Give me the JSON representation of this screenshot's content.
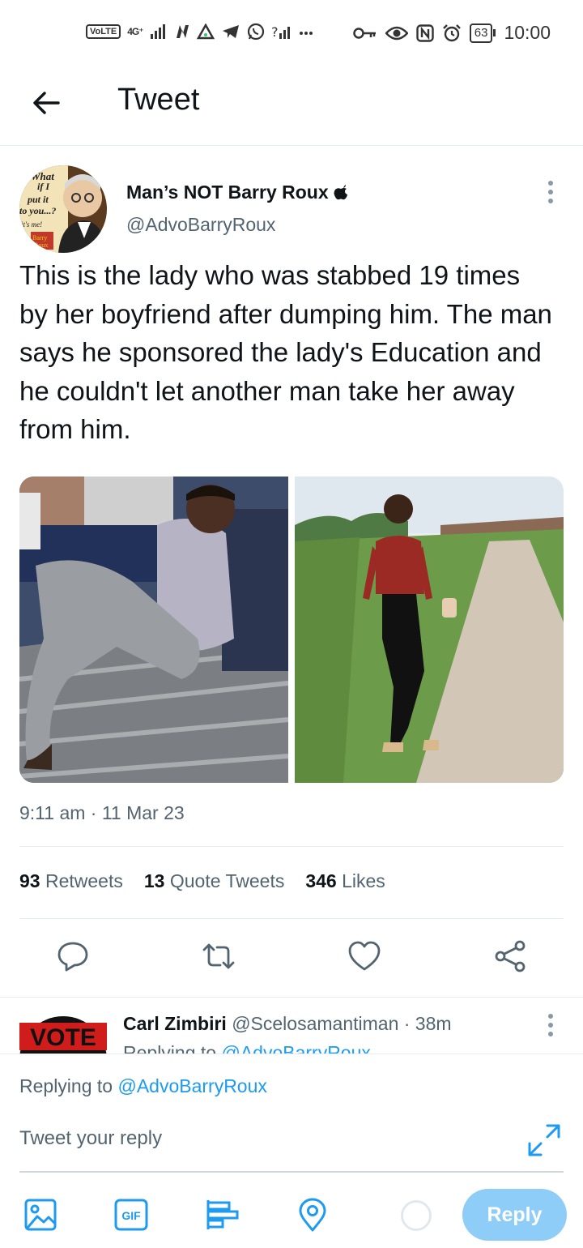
{
  "status_bar": {
    "network_label": "VoLTE",
    "signal_label": "4G⁺",
    "battery_level": "63",
    "time": "10:00"
  },
  "header": {
    "title": "Tweet"
  },
  "tweet": {
    "author_name": "Man’s NOT Barry Roux",
    "author_handle": "@AdvoBarryRoux",
    "avatar_text": [
      "What",
      "if I",
      "put it",
      "to you...?",
      "it's me!",
      "Barry",
      "Roux"
    ],
    "text": "This is the lady who was stabbed 19 times by her boyfriend after dumping him. The man says he sponsored the lady's Education and he couldn't let another man take her away from him.",
    "timestamp": "9:11 am · 11 Mar 23",
    "stats": {
      "retweets_count": "93",
      "retweets_label": "Retweets",
      "quotes_count": "13",
      "quotes_label": "Quote Tweets",
      "likes_count": "346",
      "likes_label": "Likes"
    }
  },
  "reply_preview": {
    "author_name": "Carl Zimbiri",
    "author_handle_time": "@Scelosamantiman · 38m",
    "replying_prefix": "Replying to",
    "replying_handle": "@AdvoBarryRoux",
    "avatar_text": "VOTE"
  },
  "composer": {
    "replying_prefix": "Replying to",
    "replying_handle": "@AdvoBarryRoux",
    "placeholder": "Tweet your reply",
    "gif_label": "GIF",
    "reply_button": "Reply"
  },
  "colors": {
    "accent": "#1d9bf0",
    "reply_button_disabled": "#8ecdf8",
    "secondary_text": "#536471"
  }
}
